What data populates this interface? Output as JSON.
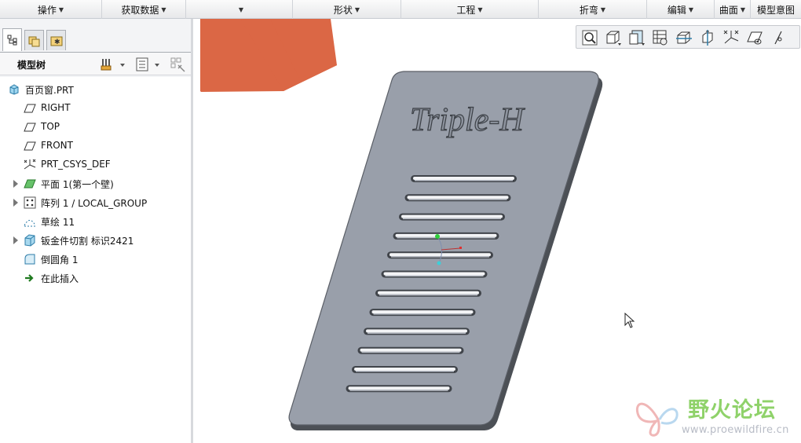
{
  "menubar": {
    "items": [
      {
        "label": "操作"
      },
      {
        "label": "获取数据"
      },
      {
        "label": ""
      },
      {
        "label": "形状"
      },
      {
        "label": "工程"
      },
      {
        "label": "折弯"
      },
      {
        "label": "编辑"
      },
      {
        "label": "曲面"
      },
      {
        "label": "模型意图"
      }
    ]
  },
  "panel": {
    "tabs": [
      "model-tree-icon",
      "layers-icon",
      "favorites-icon"
    ],
    "title": "模型树",
    "tools": [
      "settings-icon",
      "show-icon",
      "filter-icon"
    ]
  },
  "tree": {
    "items": [
      {
        "label": "百页窗.PRT",
        "icon": "part-icon"
      },
      {
        "label": "RIGHT",
        "icon": "datum-plane-icon"
      },
      {
        "label": "TOP",
        "icon": "datum-plane-icon"
      },
      {
        "label": "FRONT",
        "icon": "datum-plane-icon"
      },
      {
        "label": "PRT_CSYS_DEF",
        "icon": "csys-icon"
      },
      {
        "label": "平面 1(第一个壁)",
        "icon": "flat-wall-icon"
      },
      {
        "label": "阵列 1 / LOCAL_GROUP",
        "icon": "pattern-icon"
      },
      {
        "label": "草绘 11",
        "icon": "sketch-icon"
      },
      {
        "label": "钣金件切割 标识2421",
        "icon": "sheetmetal-cut-icon"
      },
      {
        "label": "倒圆角 1",
        "icon": "round-icon"
      },
      {
        "label": "在此插入",
        "icon": "insert-arrow-icon"
      }
    ]
  },
  "viewport": {
    "toolbar": [
      "refit-icon",
      "saved-views-icon",
      "named-view-icon",
      "display-style-icon",
      "datum-planes-icon",
      "datum-axes-icon",
      "datum-points-icon",
      "csys-display-icon",
      "annotation-icon"
    ],
    "engraved_text": "Triple-H",
    "louver_count": 12,
    "colors": {
      "plate": "#999faa",
      "plate_edge": "#4b4f55",
      "callout_arrow": "#db6745"
    }
  },
  "watermark": {
    "title": "野火论坛",
    "url": "www.proewildfire.cn"
  }
}
